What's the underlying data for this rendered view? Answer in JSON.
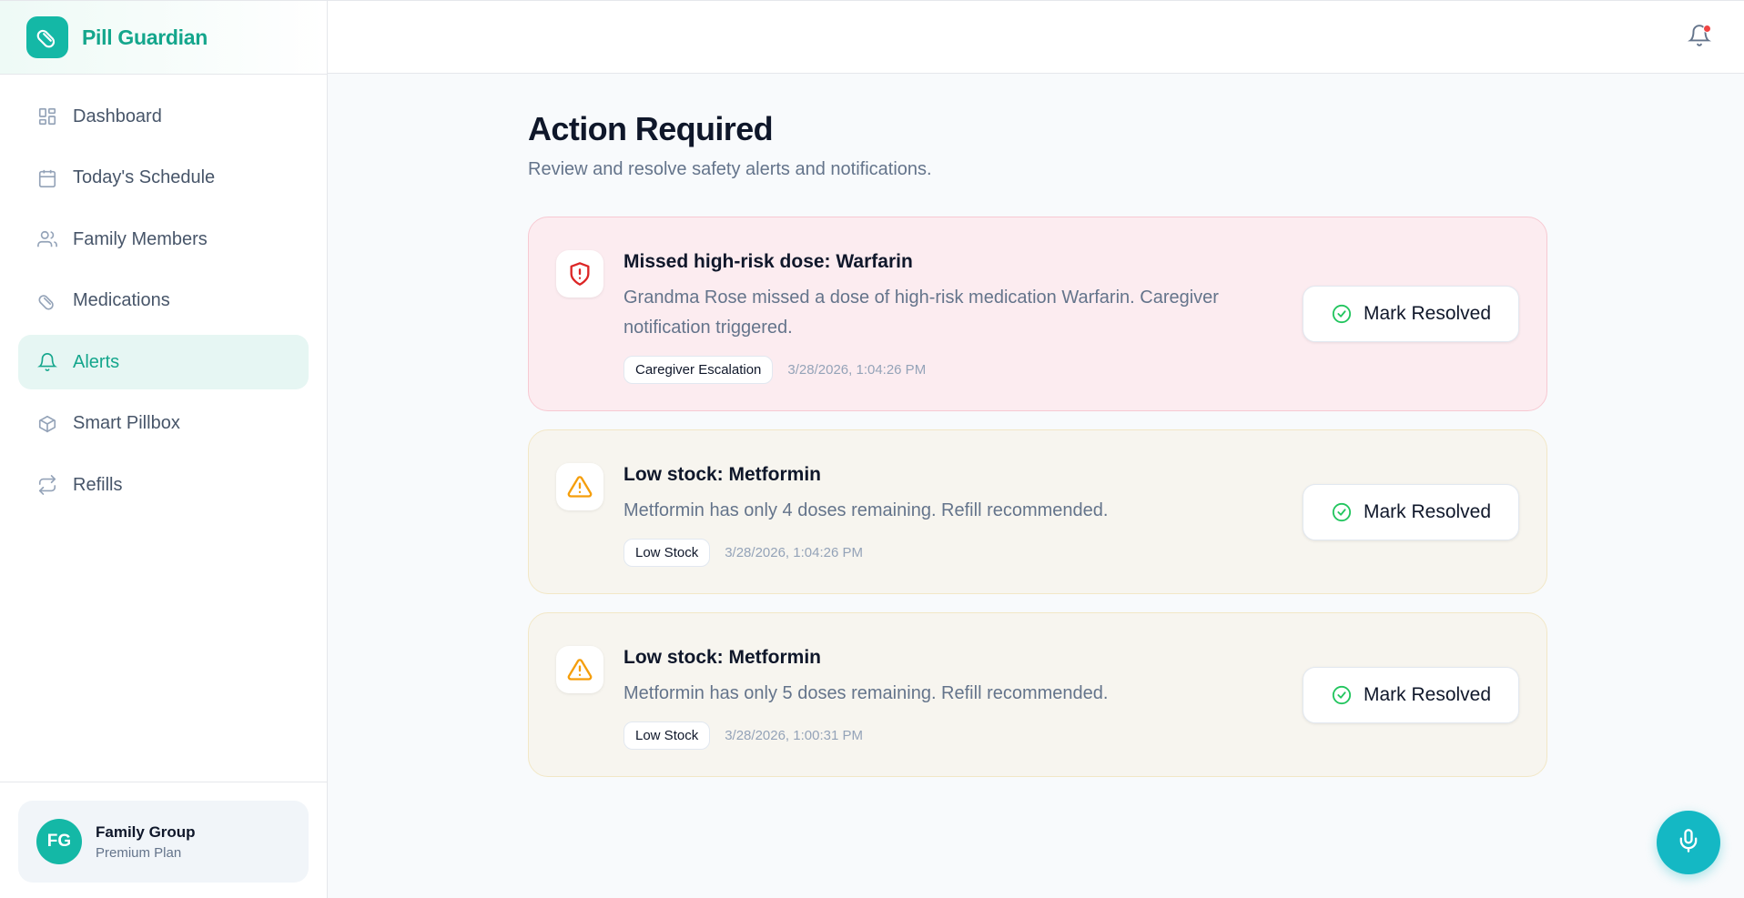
{
  "brand": {
    "name": "Pill Guardian",
    "logo_icon": "pill-icon",
    "accent": "#14b8a6"
  },
  "sidebar": {
    "items": [
      {
        "label": "Dashboard",
        "icon": "dashboard-icon",
        "active": false
      },
      {
        "label": "Today's Schedule",
        "icon": "calendar-icon",
        "active": false
      },
      {
        "label": "Family Members",
        "icon": "users-icon",
        "active": false
      },
      {
        "label": "Medications",
        "icon": "pill-icon",
        "active": false
      },
      {
        "label": "Alerts",
        "icon": "bell-icon",
        "active": true
      },
      {
        "label": "Smart Pillbox",
        "icon": "box-icon",
        "active": false
      },
      {
        "label": "Refills",
        "icon": "refresh-icon",
        "active": false
      }
    ],
    "profile": {
      "initials": "FG",
      "name": "Family Group",
      "plan": "Premium Plan"
    }
  },
  "topbar": {
    "notification_icon": "bell-icon",
    "has_unread": true
  },
  "main": {
    "title": "Action Required",
    "subtitle": "Review and resolve safety alerts and notifications.",
    "alerts": [
      {
        "severity": "critical",
        "icon": "shield-alert-icon",
        "title": "Missed high-risk dose: Warfarin",
        "description": "Grandma Rose missed a dose of high-risk medication Warfarin. Caregiver notification triggered.",
        "tag": "Caregiver Escalation",
        "timestamp": "3/28/2026, 1:04:26 PM",
        "action_label": "Mark Resolved"
      },
      {
        "severity": "warning",
        "icon": "warning-triangle-icon",
        "title": "Low stock: Metformin",
        "description": "Metformin has only 4 doses remaining. Refill recommended.",
        "tag": "Low Stock",
        "timestamp": "3/28/2026, 1:04:26 PM",
        "action_label": "Mark Resolved"
      },
      {
        "severity": "warning",
        "icon": "warning-triangle-icon",
        "title": "Low stock: Metformin",
        "description": "Metformin has only 5 doses remaining. Refill recommended.",
        "tag": "Low Stock",
        "timestamp": "3/28/2026, 1:00:31 PM",
        "action_label": "Mark Resolved"
      }
    ]
  },
  "voice_button": {
    "icon": "microphone-icon"
  }
}
